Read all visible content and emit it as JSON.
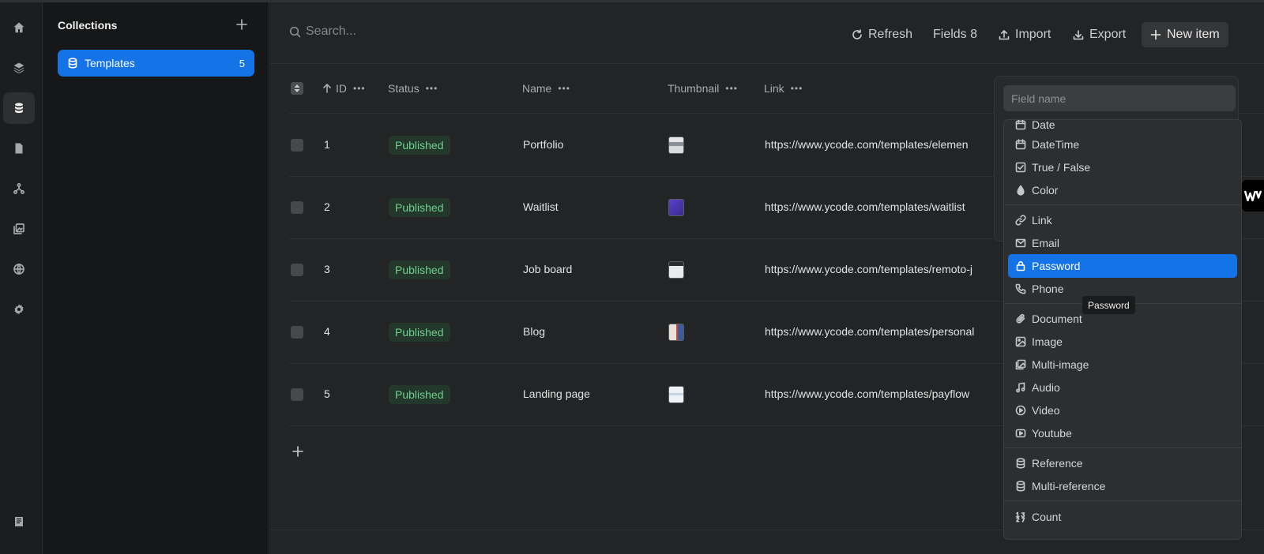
{
  "sidebar": {
    "title": "Collections",
    "items": [
      {
        "label": "Templates",
        "count": "5"
      }
    ]
  },
  "toolbar": {
    "search_placeholder": "Search...",
    "refresh_label": "Refresh",
    "fields_label": "Fields 8",
    "import_label": "Import",
    "export_label": "Export",
    "new_item_label": "New item"
  },
  "table": {
    "columns": {
      "id": "ID",
      "status": "Status",
      "name": "Name",
      "thumbnail": "Thumbnail",
      "link": "Link"
    },
    "rows": [
      {
        "id": "1",
        "status": "Published",
        "name": "Portfolio",
        "link": "https://www.ycode.com/templates/elemen"
      },
      {
        "id": "2",
        "status": "Published",
        "name": "Waitlist",
        "link": "https://www.ycode.com/templates/waitlist"
      },
      {
        "id": "3",
        "status": "Published",
        "name": "Job board",
        "link": "https://www.ycode.com/templates/remoto-j"
      },
      {
        "id": "4",
        "status": "Published",
        "name": "Blog",
        "link": "https://www.ycode.com/templates/personal"
      },
      {
        "id": "5",
        "status": "Published",
        "name": "Landing page",
        "link": "https://www.ycode.com/templates/payflow"
      }
    ]
  },
  "field_picker": {
    "input_placeholder": "Field name",
    "items": [
      {
        "label": "Date",
        "icon": "calendar-icon"
      },
      {
        "label": "DateTime",
        "icon": "calendar-icon"
      },
      {
        "label": "True / False",
        "icon": "checkbox-icon"
      },
      {
        "label": "Color",
        "icon": "droplet-icon"
      },
      {
        "label": "Link",
        "icon": "link-icon"
      },
      {
        "label": "Email",
        "icon": "mail-icon"
      },
      {
        "label": "Password",
        "icon": "lock-icon"
      },
      {
        "label": "Phone",
        "icon": "phone-icon"
      },
      {
        "label": "Document",
        "icon": "paperclip-icon"
      },
      {
        "label": "Image",
        "icon": "image-icon"
      },
      {
        "label": "Multi-image",
        "icon": "images-icon"
      },
      {
        "label": "Audio",
        "icon": "music-note-icon"
      },
      {
        "label": "Video",
        "icon": "play-circle-icon"
      },
      {
        "label": "Youtube",
        "icon": "youtube-icon"
      },
      {
        "label": "Reference",
        "icon": "database-icon"
      },
      {
        "label": "Multi-reference",
        "icon": "database-icon"
      },
      {
        "label": "Count",
        "icon": "count-icon"
      }
    ],
    "tooltip": "Password"
  },
  "colors": {
    "accent": "#1473e6",
    "published_text": "#6fd08f",
    "published_bg": "#23372a"
  }
}
